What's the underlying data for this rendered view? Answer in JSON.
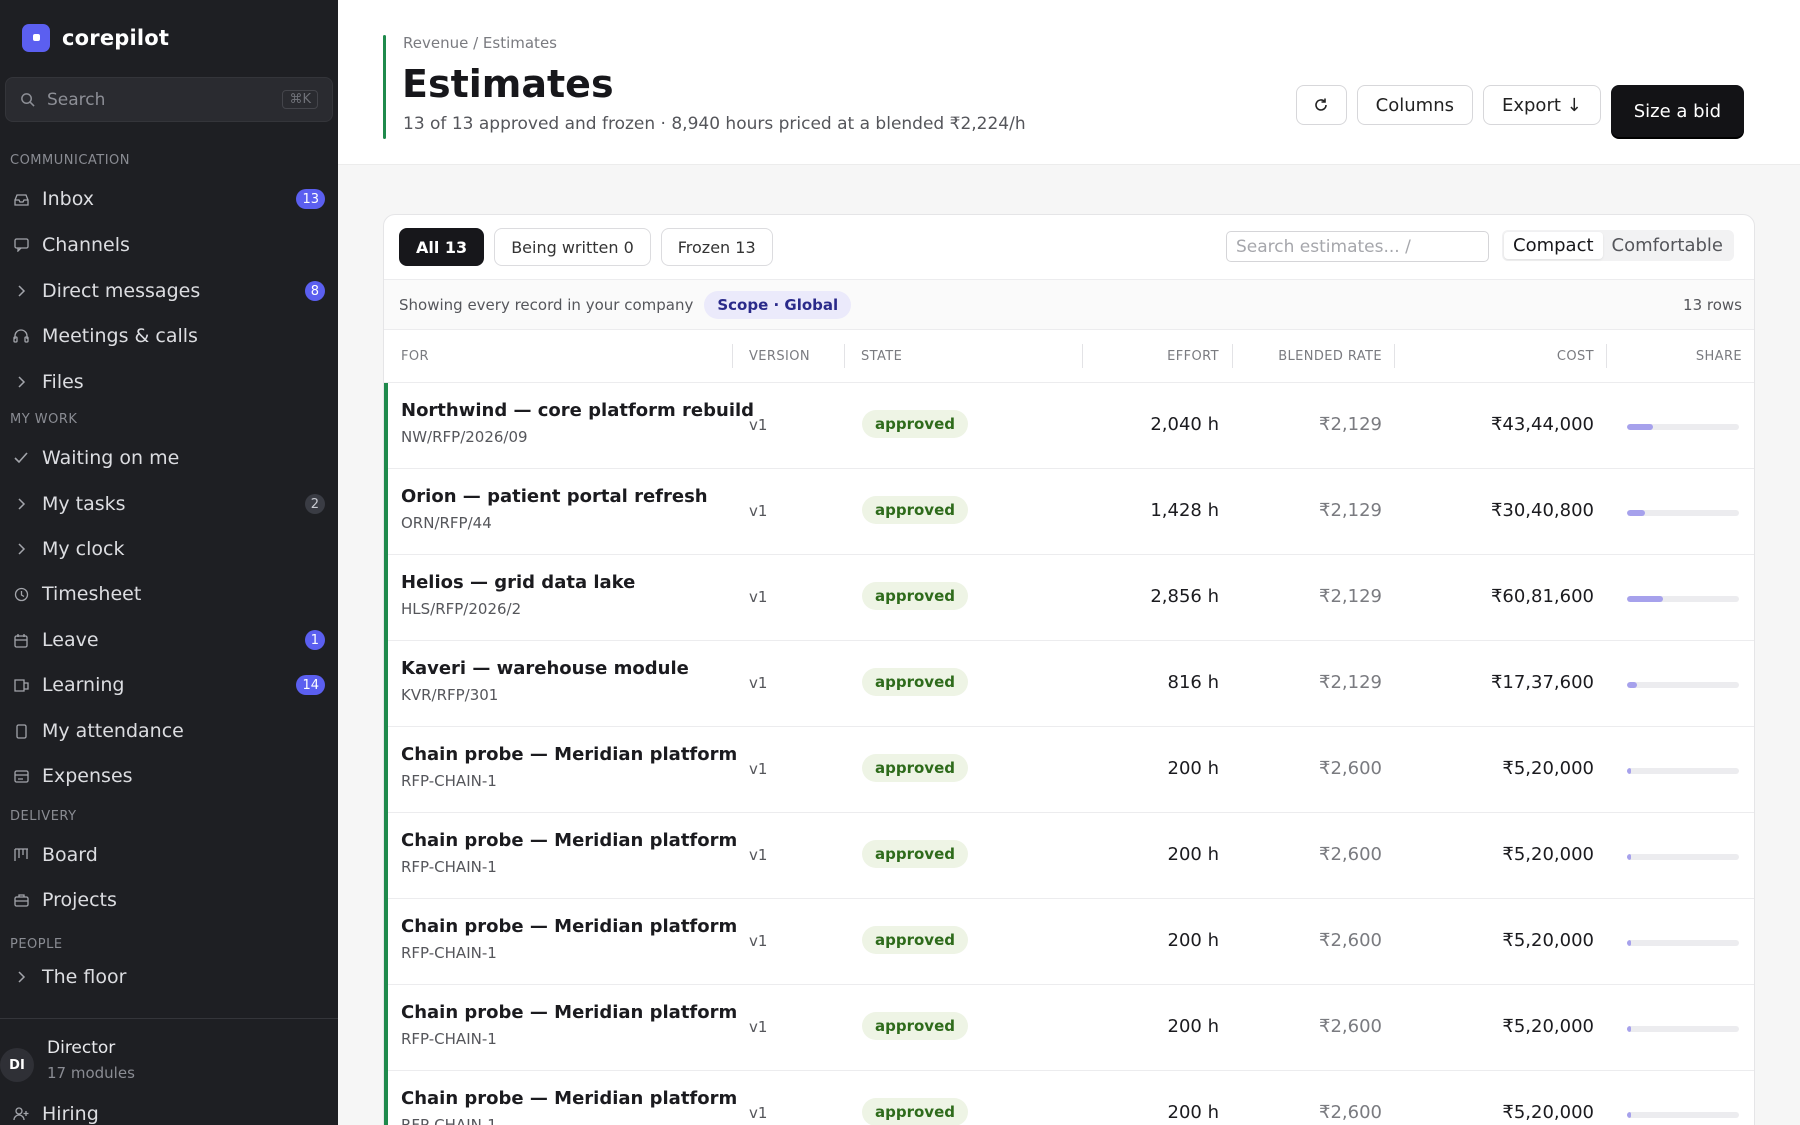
{
  "app": {
    "name": "corepilot"
  },
  "sidebar": {
    "search": {
      "placeholder": "Search",
      "shortcut": "⌘K"
    },
    "sections": {
      "communication": "COMMUNICATION",
      "my_work": "MY WORK",
      "delivery": "DELIVERY",
      "people": "PEOPLE"
    },
    "items": [
      {
        "label": "Inbox",
        "icon": "inbox-icon",
        "badge": "13"
      },
      {
        "label": "Channels",
        "icon": "chat-icon",
        "badge": ""
      },
      {
        "label": "Direct messages",
        "icon": "chevron-right-icon",
        "badge": "8"
      },
      {
        "label": "Meetings & calls",
        "icon": "headset-icon",
        "badge": ""
      },
      {
        "label": "Files",
        "icon": "chevron-right-icon",
        "badge": ""
      },
      {
        "label": "Waiting on me",
        "icon": "check-icon",
        "badge": ""
      },
      {
        "label": "My tasks",
        "icon": "chevron-right-icon",
        "badge": "2"
      },
      {
        "label": "My clock",
        "icon": "chevron-right-icon",
        "badge": ""
      },
      {
        "label": "Timesheet",
        "icon": "clock-icon",
        "badge": ""
      },
      {
        "label": "Leave",
        "icon": "calendar-icon",
        "badge": "1"
      },
      {
        "label": "Learning",
        "icon": "book-icon",
        "badge": "14"
      },
      {
        "label": "My attendance",
        "icon": "badge-icon",
        "badge": ""
      },
      {
        "label": "Expenses",
        "icon": "receipt-icon",
        "badge": ""
      },
      {
        "label": "Board",
        "icon": "kanban-icon",
        "badge": ""
      },
      {
        "label": "Projects",
        "icon": "briefcase-icon",
        "badge": ""
      },
      {
        "label": "The floor",
        "icon": "chevron-right-icon",
        "badge": ""
      },
      {
        "label": "Hiring",
        "icon": "user-plus-icon",
        "badge": ""
      }
    ],
    "profile": {
      "initials": "DI",
      "role": "Director",
      "modules": "17 modules"
    }
  },
  "header": {
    "breadcrumb": "Revenue / Estimates",
    "title": "Estimates",
    "subtitle": "13 of 13 approved and frozen · 8,940 hours priced at a blended ₹2,224/h",
    "actions": {
      "columns": "Columns",
      "export": "Export ↓",
      "primary": "Size a bid"
    }
  },
  "toolbar": {
    "tabs": [
      {
        "label": "All 13",
        "active": true
      },
      {
        "label": "Being written 0",
        "active": false
      },
      {
        "label": "Frozen 13",
        "active": false
      }
    ],
    "search_placeholder": "Search estimates...  /",
    "density": {
      "compact": "Compact",
      "comfortable": "Comfortable"
    }
  },
  "scope": {
    "text": "Showing every record in your company",
    "pill": "Scope · Global",
    "rows": "13 rows"
  },
  "columns": {
    "for": "FOR",
    "version": "VERSION",
    "state": "STATE",
    "effort": "EFFORT",
    "rate": "BLENDED RATE",
    "cost": "COST",
    "share": "SHARE"
  },
  "rows": [
    {
      "name": "Northwind — core platform rebuild",
      "code": "NW/RFP/2026/09",
      "version": "v1",
      "state": "approved",
      "effort": "2,040 h",
      "rate": "₹2,129",
      "cost": "₹43,44,000",
      "share": 0.23
    },
    {
      "name": "Orion — patient portal refresh",
      "code": "ORN/RFP/44",
      "version": "v1",
      "state": "approved",
      "effort": "1,428 h",
      "rate": "₹2,129",
      "cost": "₹30,40,800",
      "share": 0.16
    },
    {
      "name": "Helios — grid data lake",
      "code": "HLS/RFP/2026/2",
      "version": "v1",
      "state": "approved",
      "effort": "2,856 h",
      "rate": "₹2,129",
      "cost": "₹60,81,600",
      "share": 0.32
    },
    {
      "name": "Kaveri — warehouse module",
      "code": "KVR/RFP/301",
      "version": "v1",
      "state": "approved",
      "effort": "816 h",
      "rate": "₹2,129",
      "cost": "₹17,37,600",
      "share": 0.09
    },
    {
      "name": "Chain probe — Meridian platform",
      "code": "RFP-CHAIN-1",
      "version": "v1",
      "state": "approved",
      "effort": "200 h",
      "rate": "₹2,600",
      "cost": "₹5,20,000",
      "share": 0.03
    },
    {
      "name": "Chain probe — Meridian platform",
      "code": "RFP-CHAIN-1",
      "version": "v1",
      "state": "approved",
      "effort": "200 h",
      "rate": "₹2,600",
      "cost": "₹5,20,000",
      "share": 0.03
    },
    {
      "name": "Chain probe — Meridian platform",
      "code": "RFP-CHAIN-1",
      "version": "v1",
      "state": "approved",
      "effort": "200 h",
      "rate": "₹2,600",
      "cost": "₹5,20,000",
      "share": 0.03
    },
    {
      "name": "Chain probe — Meridian platform",
      "code": "RFP-CHAIN-1",
      "version": "v1",
      "state": "approved",
      "effort": "200 h",
      "rate": "₹2,600",
      "cost": "₹5,20,000",
      "share": 0.03
    },
    {
      "name": "Chain probe — Meridian platform",
      "code": "RFP-CHAIN-1",
      "version": "v1",
      "state": "approved",
      "effort": "200 h",
      "rate": "₹2,600",
      "cost": "₹5,20,000",
      "share": 0.03
    }
  ],
  "colors": {
    "accent": "#5b5ff0",
    "row_accent": "#1f8a4c",
    "approved_bg": "#eef4e5",
    "approved_text": "#2e6b1b",
    "share_fill": "#a6a1ec"
  }
}
